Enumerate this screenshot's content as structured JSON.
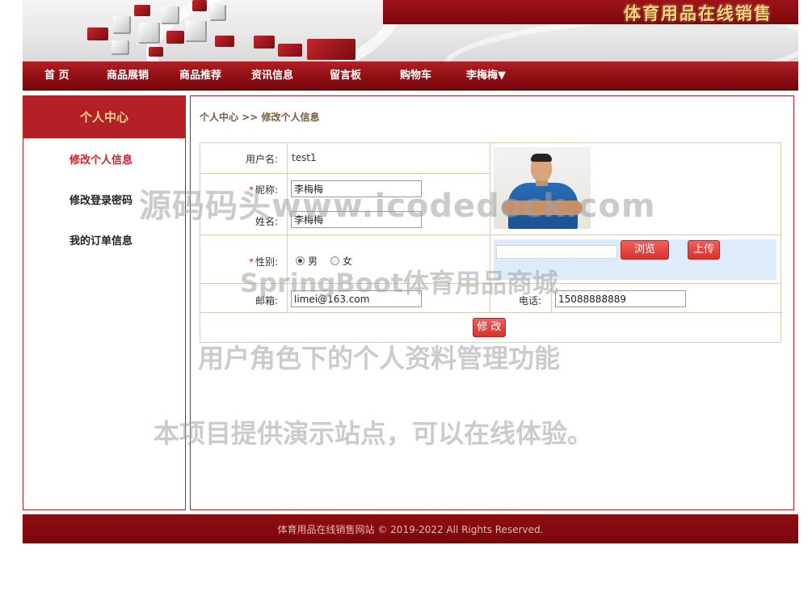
{
  "site": {
    "title": "体育用品在线销售"
  },
  "nav": {
    "items": [
      {
        "label": "首 页"
      },
      {
        "label": "商品展销"
      },
      {
        "label": "商品推荐"
      },
      {
        "label": "资讯信息"
      },
      {
        "label": "留言板"
      },
      {
        "label": "购物车"
      },
      {
        "label": "李梅梅▼"
      }
    ]
  },
  "sidebar": {
    "title": "个人中心",
    "items": [
      {
        "label": "修改个人信息",
        "active": true
      },
      {
        "label": "修改登录密码",
        "active": false
      },
      {
        "label": "我的订单信息",
        "active": false
      }
    ]
  },
  "breadcrumb": "个人中心 >> 修改个人信息",
  "form": {
    "username_label": "用户名:",
    "username_value": "test1",
    "nickname_label": "昵称:",
    "nickname_value": "李梅梅",
    "realname_label": "姓名:",
    "realname_value": "李梅梅",
    "gender_label": "性别:",
    "gender_options": [
      {
        "label": "男",
        "checked": true
      },
      {
        "label": "女",
        "checked": false
      }
    ],
    "email_label": "邮箱:",
    "email_value": "limei@163.com",
    "phone_label": "电话:",
    "phone_value": "15088888889",
    "browse_label": "浏览",
    "upload_label": "上传",
    "submit_label": "修 改",
    "required_mark": "*"
  },
  "watermarks": {
    "line1": "源码码头www.icodedock.com",
    "line2": "SpringBoot体育用品商城",
    "line3": "用户角色下的个人资料管理功能",
    "line4": "本项目提供演示站点，可以在线体验。"
  },
  "footer": {
    "text": "体育用品在线销售网站  © 2019-2022 All Rights Reserved."
  },
  "colors": {
    "brand_red": "#b32025",
    "dark_red": "#7a080c",
    "gold": "#f2d38a",
    "button_red": "#d9322c"
  }
}
